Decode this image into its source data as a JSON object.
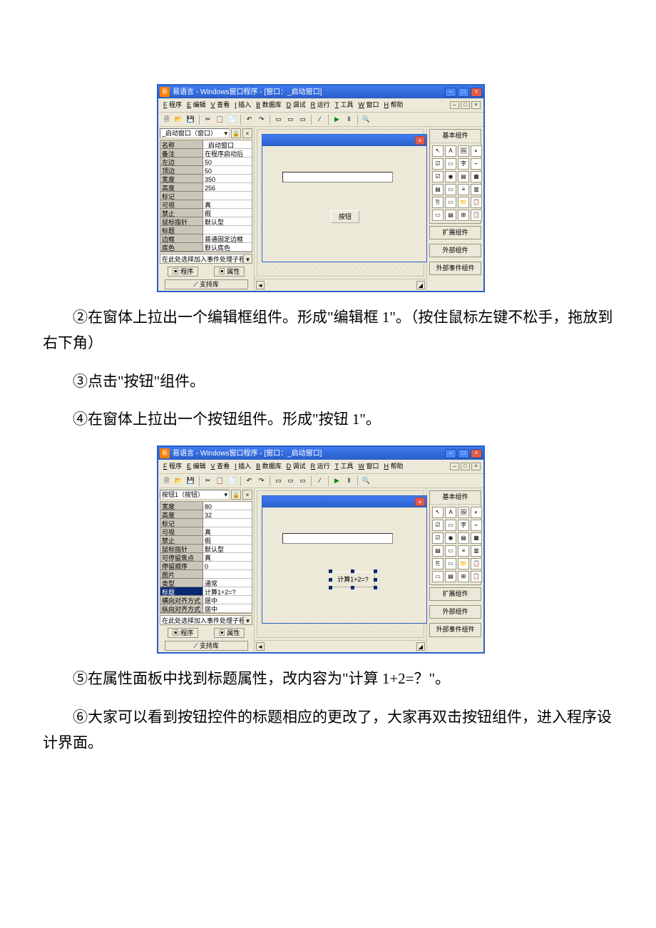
{
  "colors": {
    "titlebar": "#2a5fc9",
    "panel_bg": "#ece9d8",
    "close_btn": "#e35a4a",
    "selected_row": "#0a2870"
  },
  "shot1": {
    "window_title": "易语言 - Windows窗口程序 - [窗口：_启动窗口]",
    "menus": [
      "程序",
      "编辑",
      "查看",
      "插入",
      "数据库",
      "调试",
      "运行",
      "工具",
      "窗口",
      "帮助"
    ],
    "menu_hotkeys": [
      "F",
      "E",
      "V",
      "I",
      "B",
      "D",
      "R",
      "T",
      "W",
      "H"
    ],
    "combo_value": "_启动窗口（窗口）",
    "properties": [
      {
        "k": "名称",
        "v": "_启动窗口"
      },
      {
        "k": "备注",
        "v": "在程序启动后"
      },
      {
        "k": "左边",
        "v": "50"
      },
      {
        "k": "顶边",
        "v": "50"
      },
      {
        "k": "宽度",
        "v": "350"
      },
      {
        "k": "高度",
        "v": "256"
      },
      {
        "k": "标记",
        "v": ""
      },
      {
        "k": "可视",
        "v": "真"
      },
      {
        "k": "禁止",
        "v": "假"
      },
      {
        "k": "鼠标指针",
        "v": "默认型"
      },
      {
        "k": "标题",
        "v": ""
      },
      {
        "k": "边框",
        "v": "普通固定边框"
      },
      {
        "k": "底色",
        "v": "默认底色"
      }
    ],
    "event_combo": "在此处选择加入事件处理子程",
    "btn_prog": "▣:程序",
    "btn_prop": "▣ 属性",
    "support_lib": "⟋ 支持库",
    "designer_button_label": "按钮",
    "palette_header": "基本组件",
    "palette_btn_ext": "扩展组件",
    "palette_btn_external": "外部组件",
    "palette_btn_extevt": "外部事件组件"
  },
  "para2": "②在窗体上拉出一个编辑框组件。形成\"编辑框 1\"。（按住鼠标左键不松手，拖放到右下角）",
  "para3": "③点击\"按钮\"组件。",
  "para4": "④在窗体上拉出一个按钮组件。形成\"按钮 1\"。",
  "shot2": {
    "window_title": "易语言 - Windows窗口程序 - [窗口：_启动窗口]",
    "menus": [
      "程序",
      "编辑",
      "查看",
      "插入",
      "数据库",
      "调试",
      "运行",
      "工具",
      "窗口",
      "帮助"
    ],
    "menu_hotkeys": [
      "F",
      "E",
      "V",
      "I",
      "B",
      "D",
      "R",
      "T",
      "W",
      "H"
    ],
    "combo_value": "按钮1（按钮）",
    "properties": [
      {
        "k": "宽度",
        "v": "80"
      },
      {
        "k": "高度",
        "v": "32"
      },
      {
        "k": "标记",
        "v": ""
      },
      {
        "k": "可视",
        "v": "真"
      },
      {
        "k": "禁止",
        "v": "假"
      },
      {
        "k": "鼠标指针",
        "v": "默认型"
      },
      {
        "k": "可停留焦点",
        "v": "真"
      },
      {
        "k": "停留顺序",
        "v": "0"
      },
      {
        "k": "图片",
        "v": ""
      },
      {
        "k": "类型",
        "v": "通常"
      },
      {
        "k": "标题",
        "v": "计算1+2=?",
        "selected": true
      },
      {
        "k": "横向对齐方式",
        "v": "居中"
      },
      {
        "k": "纵向对齐方式",
        "v": "居中"
      }
    ],
    "event_combo": "在此处选择加入事件处理子程",
    "btn_prog": "▣:程序",
    "btn_prop": "▣ 属性",
    "support_lib": "⟋ 支持库",
    "designer_button_label": "计算1+2=?",
    "palette_header": "基本组件",
    "palette_btn_ext": "扩展组件",
    "palette_btn_external": "外部组件",
    "palette_btn_extevt": "外部事件组件"
  },
  "para5": "⑤在属性面板中找到标题属性，改内容为\"计算 1+2=？\"。",
  "para6": "⑥大家可以看到按钮控件的标题相应的更改了，大家再双击按钮组件，进入程序设计界面。"
}
